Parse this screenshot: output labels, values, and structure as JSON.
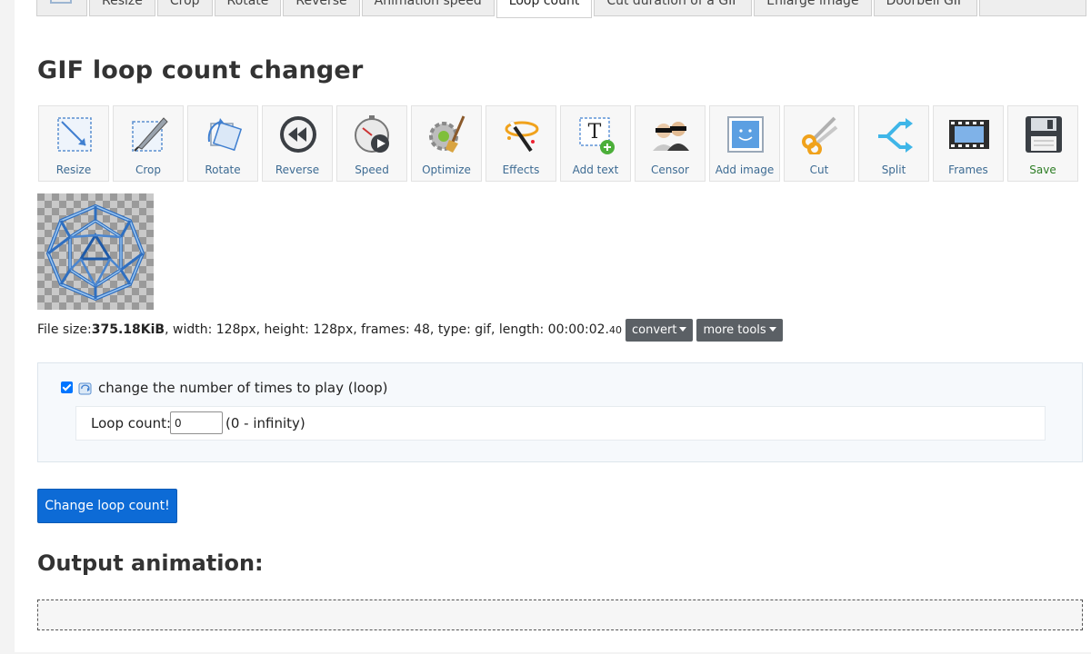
{
  "tabs": [
    {
      "label": "",
      "icon": "frames-icon"
    },
    {
      "label": "Resize"
    },
    {
      "label": "Crop"
    },
    {
      "label": "Rotate"
    },
    {
      "label": "Reverse"
    },
    {
      "label": "Animation speed"
    },
    {
      "label": "Loop count",
      "active": true
    },
    {
      "label": "Cut duration of a GIF"
    },
    {
      "label": "Enlarge image"
    },
    {
      "label": "Doorbell GIF"
    },
    {
      "label": ""
    }
  ],
  "page_title": "GIF loop count changer",
  "toolbar": [
    {
      "label": "Resize",
      "icon": "resize-icon"
    },
    {
      "label": "Crop",
      "icon": "crop-icon"
    },
    {
      "label": "Rotate",
      "icon": "rotate-icon"
    },
    {
      "label": "Reverse",
      "icon": "reverse-icon"
    },
    {
      "label": "Speed",
      "icon": "speed-icon"
    },
    {
      "label": "Optimize",
      "icon": "optimize-icon"
    },
    {
      "label": "Effects",
      "icon": "effects-icon"
    },
    {
      "label": "Add text",
      "icon": "add-text-icon"
    },
    {
      "label": "Censor",
      "icon": "censor-icon"
    },
    {
      "label": "Add image",
      "icon": "add-image-icon"
    },
    {
      "label": "Cut",
      "icon": "scissors-icon"
    },
    {
      "label": "Split",
      "icon": "split-icon"
    },
    {
      "label": "Frames",
      "icon": "film-icon"
    },
    {
      "label": "Save",
      "icon": "floppy-disk-icon"
    }
  ],
  "file_info": {
    "size_label": "File size: ",
    "size": "375.18KiB",
    "details": ", width: 128px, height: 128px, frames: 48, type: gif, length: 00:00:02.",
    "length_ms": "40"
  },
  "convert_label": "convert",
  "more_tools_label": "more tools",
  "option": {
    "checked": true,
    "label": "change the number of times to play (loop)",
    "icon": "loop-icon"
  },
  "loop": {
    "label": "Loop count:",
    "value": "0",
    "range": "(0 - infinity)"
  },
  "submit_label": "Change loop count!",
  "output_title": "Output animation:",
  "colors": {
    "primary_button": "#0d6bd6",
    "dropdown": "#5b6065",
    "tool_label": "#3d6b93",
    "save_label": "#2d7d24"
  }
}
